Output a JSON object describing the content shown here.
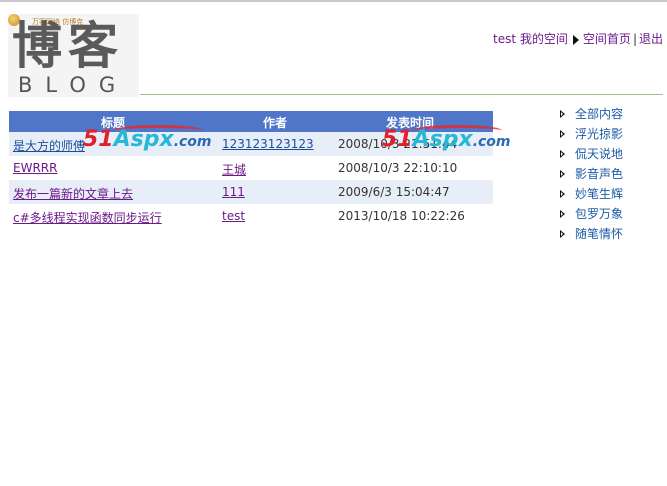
{
  "logo": {
    "main_text": "博客",
    "sub_text": "BLOG",
    "tiny_text": "万客网络 仿博克"
  },
  "header": {
    "user": "test",
    "my_space": "我的空间",
    "space_home": "空间首页",
    "separator": "|",
    "logout": "退出"
  },
  "table": {
    "headers": [
      "标题",
      "作者",
      "发表时间"
    ],
    "rows": [
      {
        "title": "是大方的师傅",
        "author": "123123123123",
        "time": "2008/10/3 21:51:44"
      },
      {
        "title": "EWRRR",
        "author": "王城",
        "time": "2008/10/3 22:10:10"
      },
      {
        "title": "发布一篇新的文章上去",
        "author": "111",
        "time": "2009/6/3 15:04:47"
      },
      {
        "title": "c#多线程实现函数同步运行",
        "author": "test",
        "time": "2013/10/18 10:22:26"
      }
    ]
  },
  "watermark": {
    "num": "51",
    "brand": "Aspx",
    "domain": ".com"
  },
  "sidebar": {
    "items": [
      {
        "label": "全部内容"
      },
      {
        "label": "浮光掠影"
      },
      {
        "label": "侃天说地"
      },
      {
        "label": "影音声色"
      },
      {
        "label": "妙笔生辉"
      },
      {
        "label": "包罗万象"
      },
      {
        "label": "随笔情怀"
      }
    ]
  },
  "colors": {
    "header_bg": "#4f76c9",
    "row_alt": "#e8eef8",
    "link": "#6b1a8a",
    "sidebar_link": "#1c5aa6"
  }
}
